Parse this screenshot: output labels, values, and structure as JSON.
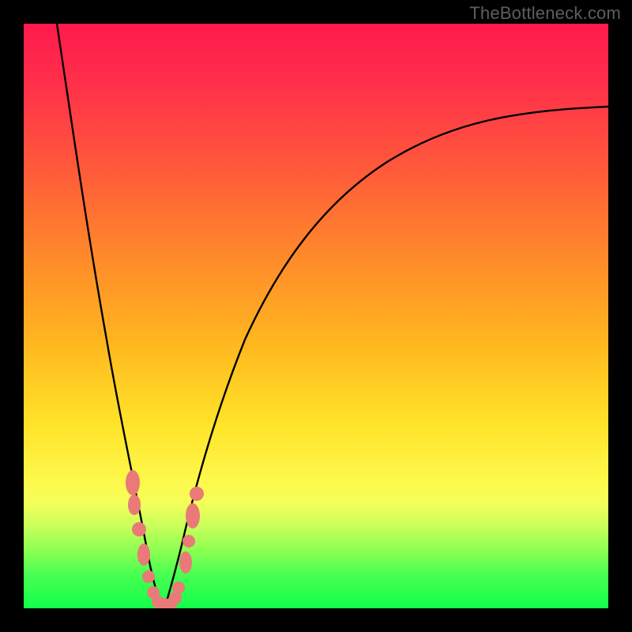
{
  "attribution": "TheBottleneck.com",
  "chart_data": {
    "type": "line",
    "title": "",
    "xlabel": "",
    "ylabel": "",
    "xlim": [
      0,
      100
    ],
    "ylim": [
      0,
      100
    ],
    "note": "V-shaped bottleneck curve; minimum (0%) near x≈23; y rises steeply toward 100% left, saturates ~80% right. Values estimated from pixel positions (no axis ticks visible).",
    "series": [
      {
        "name": "bottleneck-curve",
        "x": [
          5,
          7,
          9,
          11,
          13,
          15,
          17,
          19,
          21,
          22,
          23,
          24,
          25,
          27,
          30,
          35,
          40,
          45,
          50,
          55,
          60,
          65,
          70,
          75,
          80,
          85,
          90,
          95,
          100
        ],
        "values": [
          100,
          90,
          78,
          65,
          53,
          41,
          30,
          19,
          9,
          4,
          1,
          0,
          2,
          8,
          18,
          32,
          43,
          51,
          58,
          63,
          67,
          70,
          73,
          75,
          77,
          78,
          79,
          80,
          81
        ]
      }
    ],
    "markers": {
      "name": "gpu-markers",
      "note": "Salmon dot/oval markers clustered around the curve minimum.",
      "points_approx_x": [
        18.5,
        18.7,
        19.5,
        21.0,
        21.3,
        22.5,
        22.8,
        23.5,
        23.8,
        24.2,
        24.8,
        26.5,
        26.8,
        27.5,
        28.0
      ],
      "points_approx_y": [
        22,
        18,
        12,
        6,
        3,
        1.5,
        0.5,
        0,
        0.3,
        2,
        3,
        9,
        12,
        16,
        21
      ]
    },
    "gradient_bands": [
      {
        "color": "#ff1a4d",
        "at_y": 100
      },
      {
        "color": "#ff8a2a",
        "at_y": 60
      },
      {
        "color": "#ffe228",
        "at_y": 30
      },
      {
        "color": "#12ff4a",
        "at_y": 0
      }
    ]
  }
}
